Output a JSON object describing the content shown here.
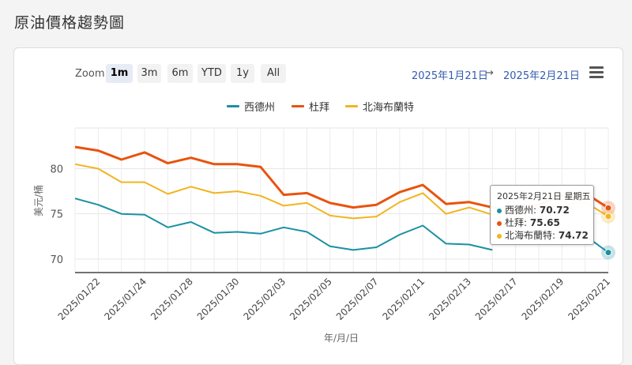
{
  "page": {
    "title": "原油價格趨勢圖"
  },
  "toolbar": {
    "zoom_label": "Zoom",
    "zoom_buttons": [
      "1m",
      "3m",
      "6m",
      "YTD",
      "1y",
      "All"
    ],
    "active_zoom": "1m",
    "range_from": "2025年1月21日",
    "range_arrow": "→",
    "range_to": "2025年2月21日"
  },
  "colors": {
    "西德州": "#1a91a1",
    "杜拜": "#e8530e",
    "北海布蘭特": "#f2b420"
  },
  "chart_data": {
    "type": "line",
    "title": "",
    "xlabel": "年/月/日",
    "ylabel": "美元/桶",
    "ylim": [
      68.5,
      84.5
    ],
    "yticks": [
      70,
      75,
      80
    ],
    "grid": true,
    "legend_position": "top-center",
    "x": [
      "2025/01/21",
      "2025/01/22",
      "2025/01/23",
      "2025/01/24",
      "2025/01/27",
      "2025/01/28",
      "2025/01/29",
      "2025/01/30",
      "2025/01/31",
      "2025/02/03",
      "2025/02/04",
      "2025/02/05",
      "2025/02/06",
      "2025/02/07",
      "2025/02/10",
      "2025/02/11",
      "2025/02/12",
      "2025/02/13",
      "2025/02/14",
      "2025/02/17",
      "2025/02/18",
      "2025/02/19",
      "2025/02/20",
      "2025/02/21"
    ],
    "xtick_labels": [
      "2025/01/22",
      "2025/01/24",
      "2025/01/28",
      "2025/01/30",
      "2025/02/03",
      "2025/02/05",
      "2025/02/07",
      "2025/02/11",
      "2025/02/13",
      "2025/02/17",
      "2025/02/19",
      "2025/02/21"
    ],
    "series": [
      {
        "name": "西德州",
        "values": [
          76.7,
          76.0,
          75.0,
          74.9,
          73.5,
          74.1,
          72.9,
          73.0,
          72.8,
          73.5,
          73.0,
          71.4,
          71.0,
          71.3,
          72.7,
          73.7,
          71.7,
          71.6,
          71.0,
          null,
          72.2,
          72.5,
          72.6,
          70.72
        ]
      },
      {
        "name": "杜拜",
        "values": [
          82.4,
          82.0,
          81.0,
          81.8,
          80.6,
          81.2,
          80.5,
          80.5,
          80.2,
          77.1,
          77.3,
          76.2,
          75.7,
          76.0,
          77.4,
          78.2,
          76.1,
          76.3,
          75.7,
          75.6,
          76.0,
          77.0,
          77.3,
          75.65
        ]
      },
      {
        "name": "北海布蘭特",
        "values": [
          80.5,
          80.0,
          78.5,
          78.5,
          77.2,
          78.0,
          77.3,
          77.5,
          77.0,
          75.9,
          76.2,
          74.8,
          74.5,
          74.7,
          76.3,
          77.3,
          75.0,
          75.7,
          74.9,
          74.9,
          75.4,
          76.0,
          76.3,
          74.72
        ]
      }
    ],
    "tooltip": {
      "header": "2025年2月21日 星期五",
      "rows": [
        {
          "name": "西德州",
          "value": "70.72"
        },
        {
          "name": "杜拜",
          "value": "75.65"
        },
        {
          "name": "北海布蘭特",
          "value": "74.72"
        }
      ]
    }
  }
}
